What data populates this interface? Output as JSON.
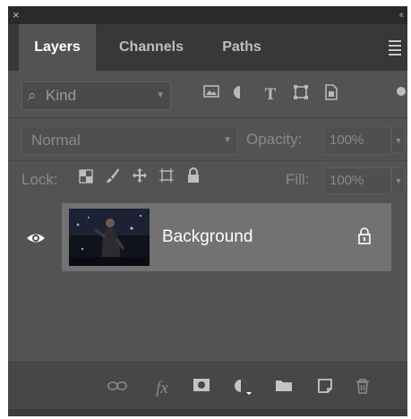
{
  "titlebar": {
    "close": "×",
    "collapse": "‹‹"
  },
  "tabs": [
    {
      "label": "Layers",
      "active": true
    },
    {
      "label": "Channels",
      "active": false
    },
    {
      "label": "Paths",
      "active": false
    }
  ],
  "filter": {
    "search_icon": "⌕",
    "kind_label": "Kind",
    "icons": [
      "image-filter-icon",
      "adjustment-filter-icon",
      "type-filter-icon",
      "shape-filter-icon",
      "smart-object-filter-icon"
    ],
    "type_glyph": "T"
  },
  "blend": {
    "mode": "Normal",
    "opacity_label": "Opacity:",
    "opacity_value": "100%"
  },
  "lock": {
    "label": "Lock:",
    "fill_label": "Fill:",
    "fill_value": "100%"
  },
  "layers": [
    {
      "name": "Background",
      "visible": true,
      "locked": true
    }
  ],
  "bottom_icons": [
    "link-layers-icon",
    "fx-icon",
    "add-mask-icon",
    "new-adjustment-layer-icon",
    "new-group-icon",
    "new-layer-icon",
    "delete-layer-icon"
  ],
  "fx_label": "fx",
  "colors": {
    "panel": "#535353",
    "tabbar": "#383838",
    "selected_layer": "#727272",
    "frame": "#1a1a1a"
  }
}
